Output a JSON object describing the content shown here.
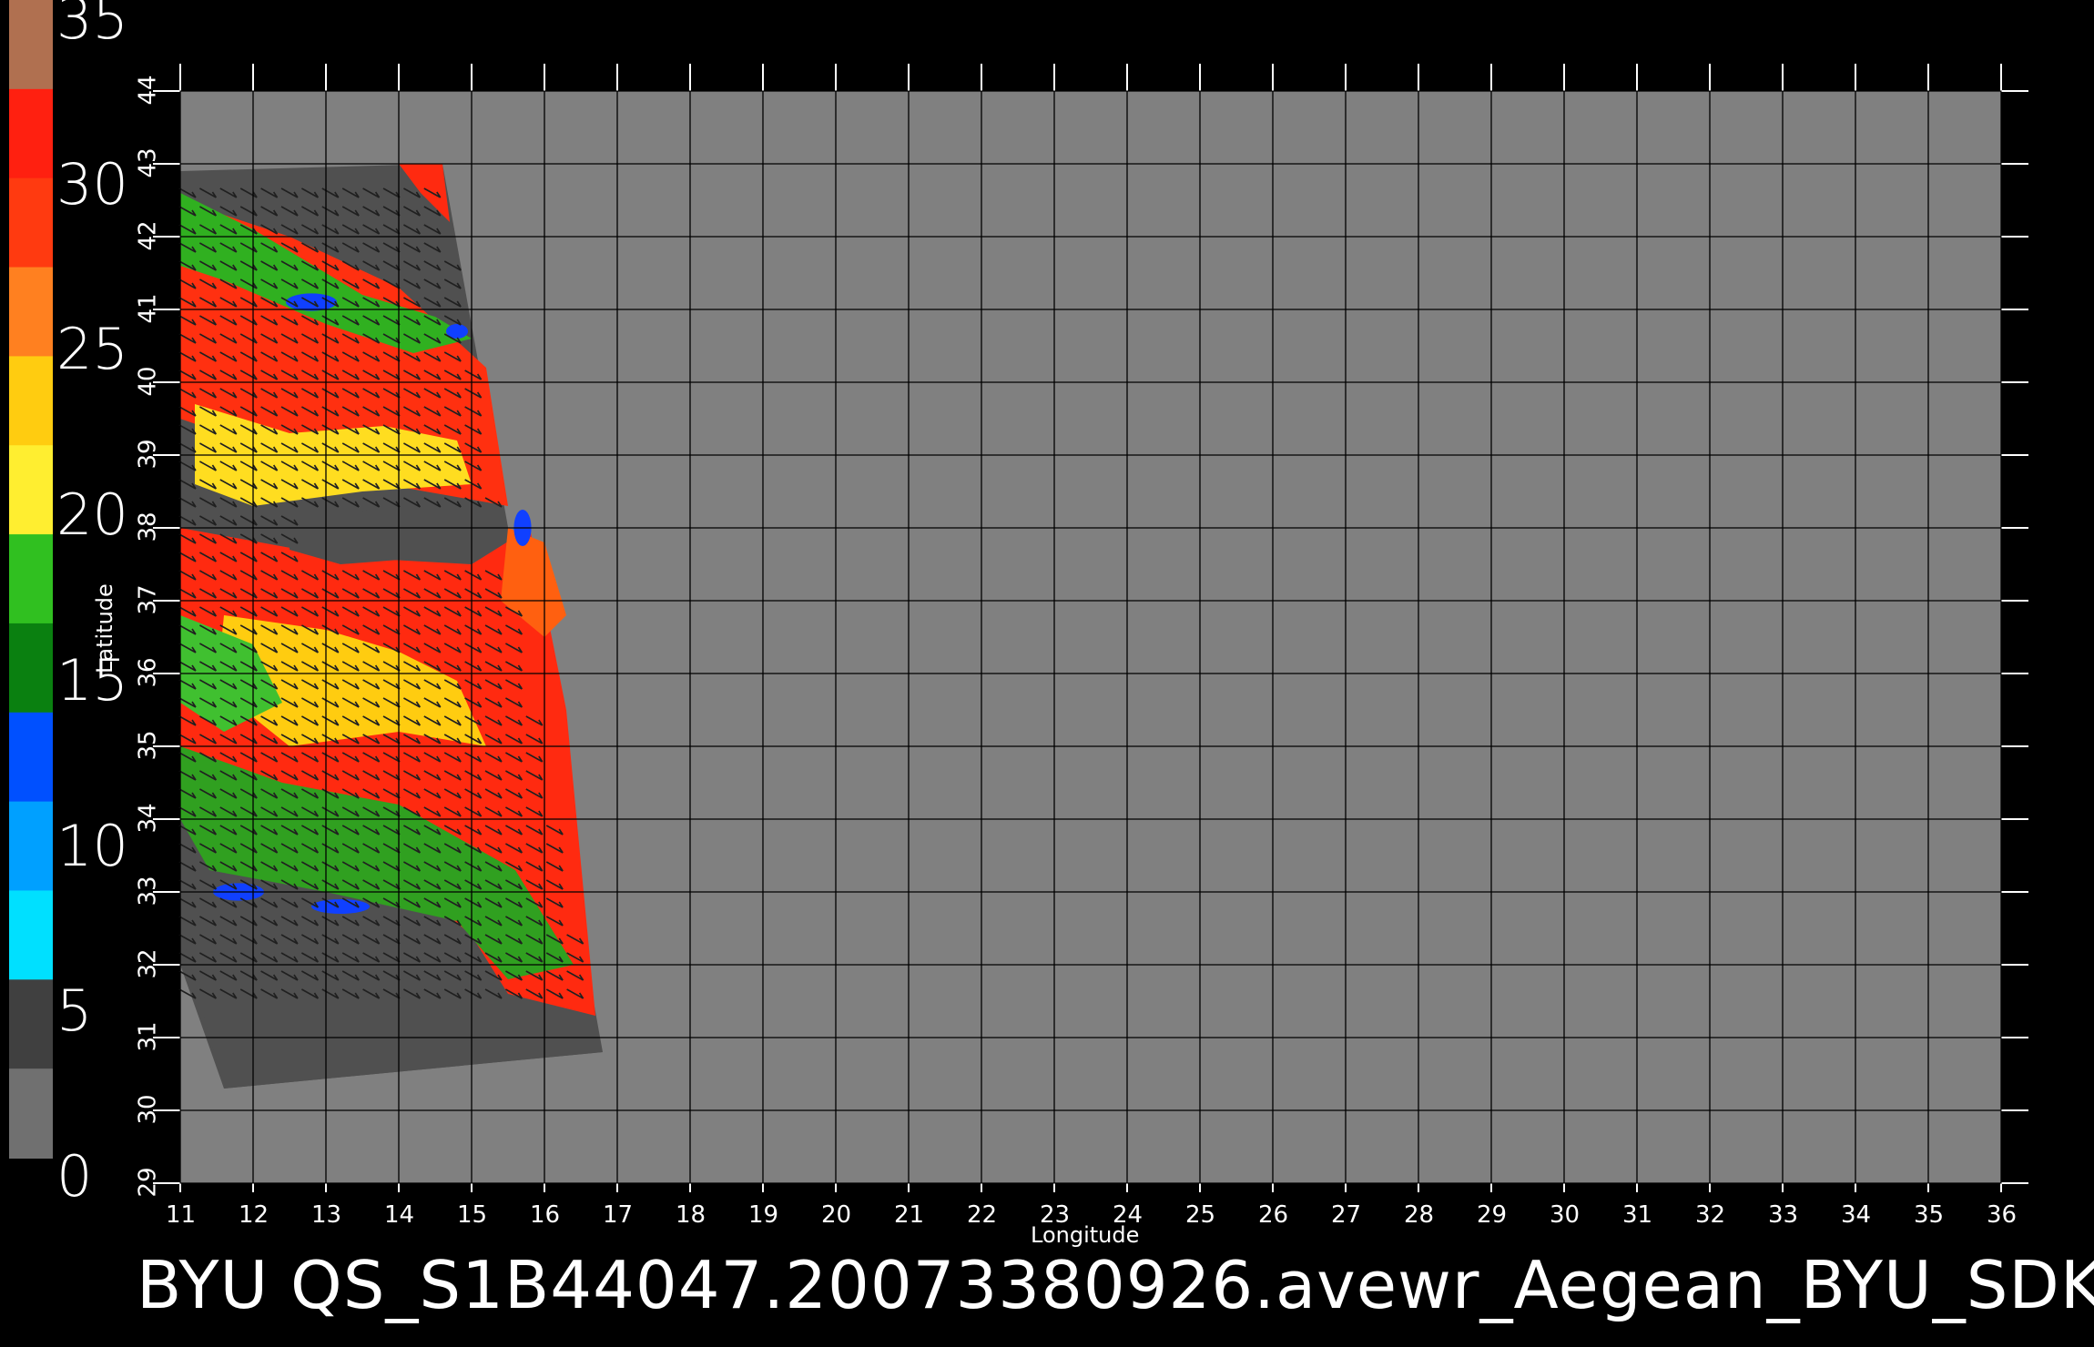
{
  "colorbar": {
    "ticks": [
      "35",
      "30",
      "25",
      "20",
      "15",
      "10",
      "5",
      "0"
    ],
    "bands": [
      "#b07050",
      "#ff2010",
      "#ff3a10",
      "#ff8020",
      "#ffcc10",
      "#ffee30",
      "#30c020",
      "#0a8010",
      "#0050ff",
      "#00a0ff",
      "#00e0ff",
      "#404040",
      "#707070"
    ]
  },
  "chart_data": {
    "type": "heatmap",
    "xlabel": "Longitude",
    "ylabel": "Latitude",
    "xlim": [
      11,
      36
    ],
    "ylim": [
      29,
      44
    ],
    "x_ticks": [
      "11",
      "12",
      "13",
      "14",
      "15",
      "16",
      "17",
      "18",
      "19",
      "20",
      "21",
      "22",
      "23",
      "24",
      "25",
      "26",
      "27",
      "28",
      "29",
      "30",
      "31",
      "32",
      "33",
      "34",
      "35",
      "36"
    ],
    "y_ticks": [
      "29",
      "30",
      "31",
      "32",
      "33",
      "34",
      "35",
      "36",
      "37",
      "38",
      "39",
      "40",
      "41",
      "42",
      "43",
      "44"
    ],
    "grid": true,
    "colorbar_range": [
      0,
      35
    ],
    "colors": {
      "background": "#808080",
      "swath": "#505050",
      "grid": "#000000"
    }
  },
  "footer": "BYU  QS_S1B44047.20073380926.avewr_Aegean_BYU_SDK"
}
